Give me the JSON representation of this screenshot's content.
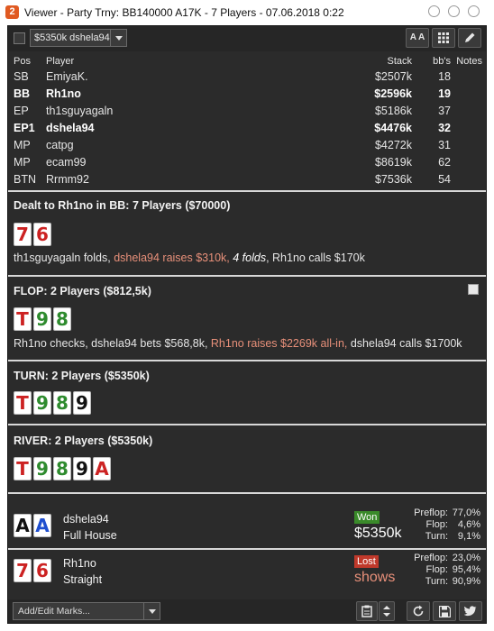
{
  "window": {
    "title": "Viewer - Party Trny: BB140000 A17K - 7 Players - 07.06.2018 0:22",
    "app_icon": "2"
  },
  "toolbar": {
    "hand_select_value": "$5350k dshela94",
    "font_size_label": "A A",
    "icons": [
      "grid-icon",
      "pencil-icon"
    ]
  },
  "players": {
    "headers": {
      "pos": "Pos",
      "player": "Player",
      "stack": "Stack",
      "bbs": "bb's",
      "notes": "Notes"
    },
    "rows": [
      {
        "pos": "SB",
        "player": "EmiyaK.",
        "stack": "$2507k",
        "bbs": "18",
        "bold": false
      },
      {
        "pos": "BB",
        "player": "Rh1no",
        "stack": "$2596k",
        "bbs": "19",
        "bold": true
      },
      {
        "pos": "EP",
        "player": "th1sguyagaln",
        "stack": "$5186k",
        "bbs": "37",
        "bold": false
      },
      {
        "pos": "EP1",
        "player": "dshela94",
        "stack": "$4476k",
        "bbs": "32",
        "bold": true
      },
      {
        "pos": "MP",
        "player": "catpg",
        "stack": "$4272k",
        "bbs": "31",
        "bold": false
      },
      {
        "pos": "MP",
        "player": "ecam99",
        "stack": "$8619k",
        "bbs": "62",
        "bold": false
      },
      {
        "pos": "BTN",
        "player": "Rrmm92",
        "stack": "$7536k",
        "bbs": "54",
        "bold": false
      }
    ]
  },
  "preflop": {
    "title": "Dealt to Rh1no in BB: 7 Players ($70000)",
    "cards": [
      {
        "rank": "7",
        "suit": "hearts"
      },
      {
        "rank": "6",
        "suit": "hearts"
      }
    ],
    "action": {
      "p1": "th1sguyagaln folds, ",
      "p2": "dshela94 raises $310k, ",
      "p3": "4 folds",
      "p4": ", Rh1no calls $170k"
    }
  },
  "flop": {
    "title": "FLOP: 2 Players ($812,5k)",
    "cards": [
      {
        "rank": "T",
        "suit": "hearts"
      },
      {
        "rank": "9",
        "suit": "clubs"
      },
      {
        "rank": "8",
        "suit": "clubs"
      }
    ],
    "action": {
      "p1": "Rh1no checks, dshela94 bets $568,8k, ",
      "p2": "Rh1no raises $2269k all-in, ",
      "p3": "dshela94 calls $1700k"
    }
  },
  "turn": {
    "title": "TURN: 2 Players ($5350k)",
    "cards": [
      {
        "rank": "T",
        "suit": "hearts"
      },
      {
        "rank": "9",
        "suit": "clubs"
      },
      {
        "rank": "8",
        "suit": "clubs"
      },
      {
        "rank": "9",
        "suit": "spades"
      }
    ]
  },
  "river": {
    "title": "RIVER: 2 Players ($5350k)",
    "cards": [
      {
        "rank": "T",
        "suit": "hearts"
      },
      {
        "rank": "9",
        "suit": "clubs"
      },
      {
        "rank": "8",
        "suit": "clubs"
      },
      {
        "rank": "9",
        "suit": "spades"
      },
      {
        "rank": "A",
        "suit": "hearts"
      }
    ]
  },
  "results": [
    {
      "player": "dshela94",
      "hand": "Full House",
      "cards": [
        {
          "rank": "A",
          "suit": "spades"
        },
        {
          "rank": "A",
          "suit": "diamonds"
        }
      ],
      "badge": "Won",
      "amount": "$5350k",
      "equity": {
        "preflop_label": "Preflop:",
        "preflop": "77,0%",
        "flop_label": "Flop:",
        "flop": "4,6%",
        "turn_label": "Turn:",
        "turn": "9,1%"
      }
    },
    {
      "player": "Rh1no",
      "hand": "Straight",
      "cards": [
        {
          "rank": "7",
          "suit": "hearts"
        },
        {
          "rank": "6",
          "suit": "hearts"
        }
      ],
      "badge": "Lost",
      "amount": "shows",
      "equity": {
        "preflop_label": "Preflop:",
        "preflop": "23,0%",
        "flop_label": "Flop:",
        "flop": "95,4%",
        "turn_label": "Turn:",
        "turn": "90,9%"
      }
    }
  ],
  "footer": {
    "marks_label": "Add/Edit Marks...",
    "icons": [
      "clipboard-icon",
      "stepper-icon",
      "refresh-icon",
      "save-icon",
      "twitter-icon"
    ]
  },
  "colors": {
    "panel_bg": "#2b2b2b",
    "highlight": "#e8907a",
    "won_badge": "#3a8a2a",
    "lost_badge": "#c0392b",
    "hearts": "#cc2222",
    "clubs": "#2e8b2e",
    "spades": "#111111",
    "diamonds": "#1f4fcf"
  }
}
